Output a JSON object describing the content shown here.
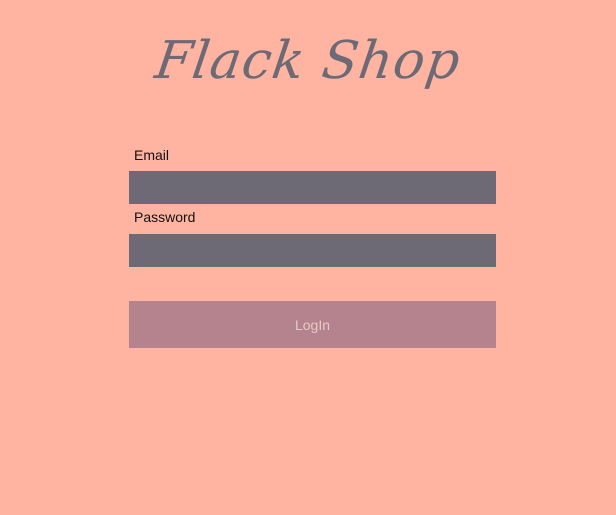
{
  "app": {
    "logo_text": "Flack Shop"
  },
  "form": {
    "email_label": "Email",
    "email_value": "",
    "password_label": "Password",
    "password_value": "",
    "login_label": "LogIn"
  },
  "colors": {
    "background": "#ffb4a2",
    "input_fill": "#6d6a75",
    "button_fill": "#b5838d",
    "logo": "#6d6a75"
  }
}
